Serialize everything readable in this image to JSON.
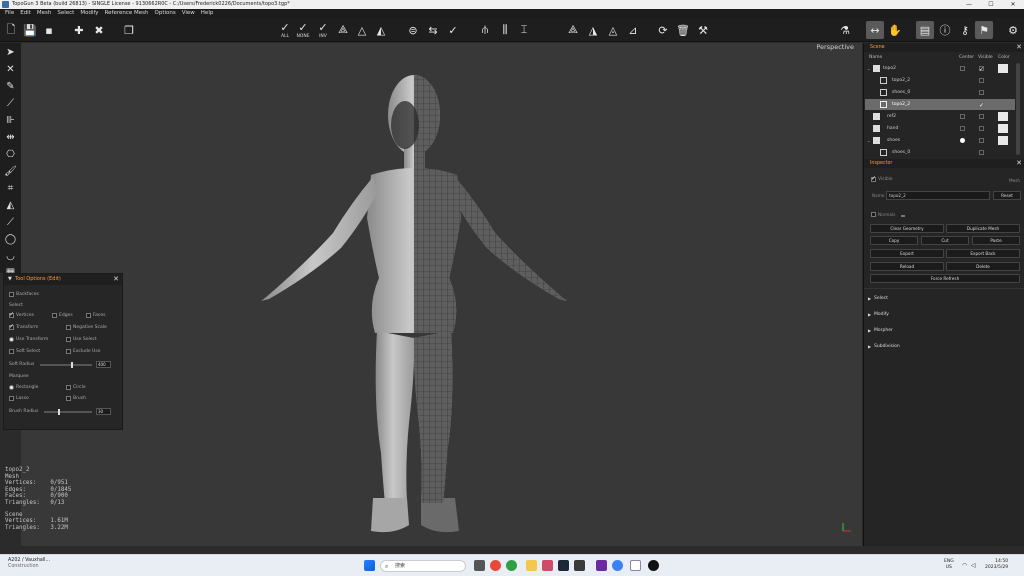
{
  "window": {
    "title": "TopoGun 3 Beta (build 26813) - SINGLE License - 9130662R0C - C:/Users/Frederick0226/Documents/topo3.tgp*",
    "controls": [
      "—",
      "☐",
      "✕"
    ]
  },
  "menu": [
    "File",
    "Edit",
    "Mesh",
    "Select",
    "Modify",
    "Reference Mesh",
    "Options",
    "View",
    "Help"
  ],
  "toolbar": {
    "select_all": "ALL",
    "select_none": "NONE",
    "select_inv": "INV"
  },
  "viewport": {
    "view_label": "Perspective"
  },
  "tool_options": {
    "title": "Tool Options (Edit)",
    "backfaces": "Backfaces",
    "select_header": "Select",
    "vertices": "Vertices",
    "edges": "Edges",
    "faces": "Faces",
    "transform": "Transform",
    "negative_scale": "Negative Scale",
    "use_transform": "Use Transform",
    "use_select": "Use Select",
    "soft_select": "Soft Select",
    "exclude_use": "Exclude Use",
    "soft_radius_label": "Soft Radius",
    "soft_radius_value": "400",
    "soft_radius_level": 0.62,
    "marquee_header": "Marquee",
    "rectangle": "Rectangle",
    "circle": "Circle",
    "lasso": "Lasso",
    "brush": "Brush",
    "brush_radius_label": "Brush Radius",
    "brush_radius_value": "30",
    "brush_radius_level": 0.3
  },
  "stats": {
    "object_name": "topo2_2",
    "object_type": "Mesh",
    "vertices": "Vertices:    0/951",
    "edges": "Edges:       0/1845",
    "faces": "Faces:       0/900",
    "triangles": "Triangles:   0/13",
    "scene_label": "Scene",
    "scene_vertices": "Vertices:    1.61M",
    "scene_triangles": "Triangles:   3.22M"
  },
  "scene_panel": {
    "title": "Scene",
    "col_name": "Name",
    "col_center": "Center",
    "col_visible": "Visible",
    "col_color": "Color",
    "rows": [
      {
        "name": "topo2",
        "indent": 0
      },
      {
        "name": "topo2_2",
        "indent": 1
      },
      {
        "name": "shoes_0",
        "indent": 1
      },
      {
        "name": "topo2_2",
        "indent": 1
      },
      {
        "name": "ref2",
        "indent": 0
      },
      {
        "name": "hand",
        "indent": 0
      },
      {
        "name": "shoes",
        "indent": 0
      },
      {
        "name": "shoes_0",
        "indent": 1
      }
    ]
  },
  "inspector": {
    "title": "Inspector",
    "visible_label": "Visible",
    "mesh_label": "Mesh",
    "name_label": "Name",
    "name_value": "topo2_2",
    "reset": "Reset",
    "normals": "Normals",
    "clear_geometry": "Clear Geometry",
    "duplicate_mesh": "Duplicate Mesh",
    "copy": "Copy",
    "cut": "Cut",
    "paste": "Paste",
    "export": "Export",
    "export_back": "Export Back",
    "reload": "Reload",
    "delete": "Delete",
    "force_refresh": "Force Refresh",
    "sections": [
      "Select",
      "Modify",
      "Morpher",
      "Subdivision"
    ]
  },
  "taskbar": {
    "news_title": "A202 / Vauxhall...",
    "news_sub": "Construction",
    "search_placeholder": "搜索",
    "lang_top": "ENG",
    "lang_bottom": "US",
    "time": "14:50",
    "date": "2023/5/29"
  }
}
